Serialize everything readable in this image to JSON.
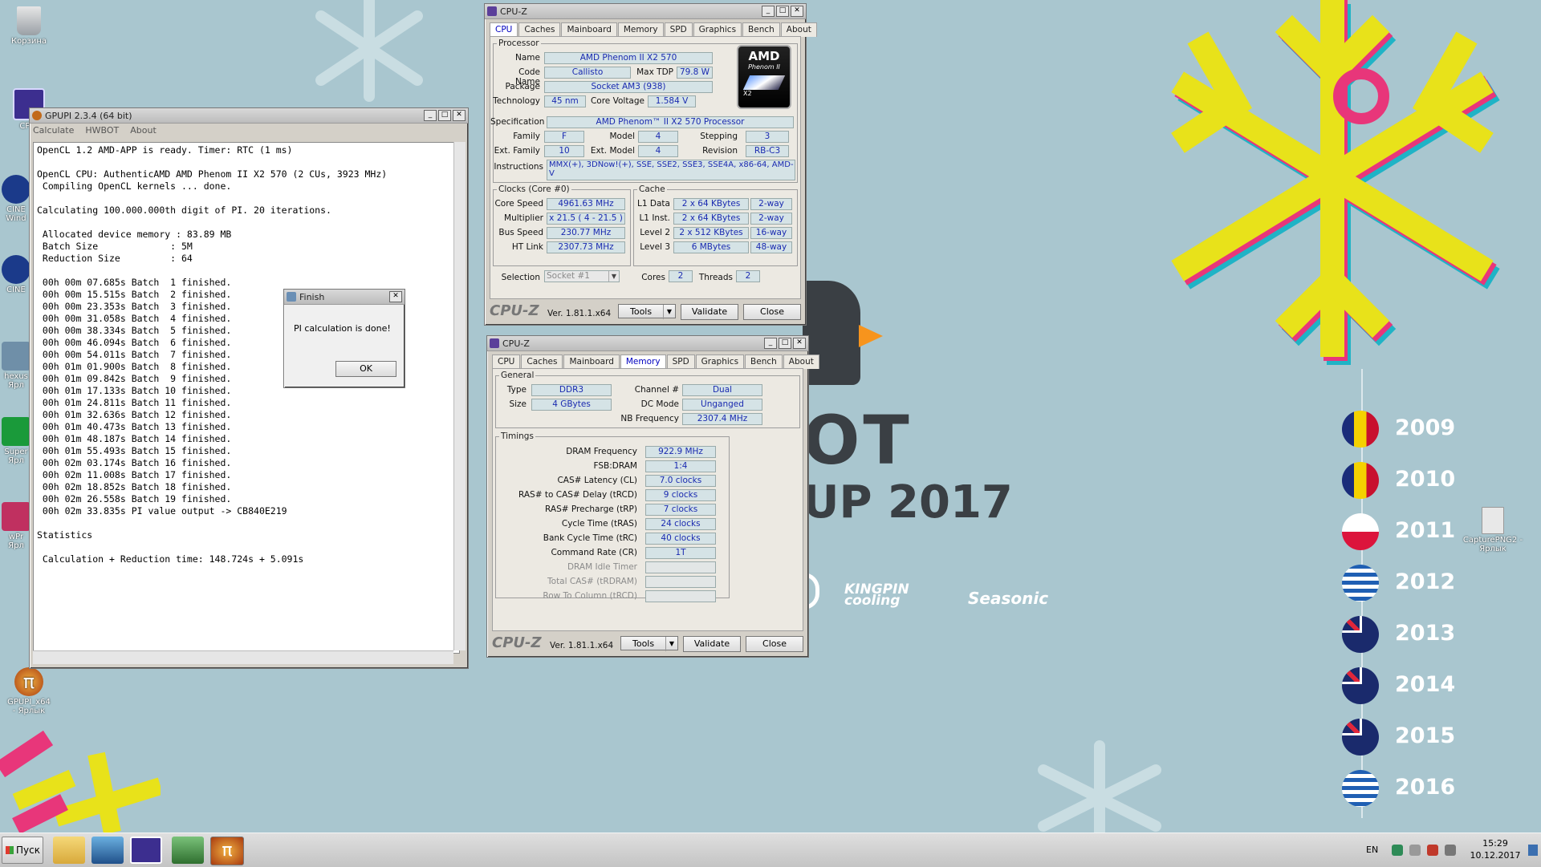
{
  "desktop": {
    "event_text_1": "OT",
    "event_text_2": "UP 2017",
    "sponsor_1": "KINGPIN cooling",
    "sponsor_2": "Seasonic",
    "years": [
      "2009",
      "2010",
      "2011",
      "2012",
      "2013",
      "2014",
      "2015",
      "2016"
    ],
    "icons": [
      {
        "label": "Корзина"
      },
      {
        "label": "CPUI"
      },
      {
        "label": "CINE Wind"
      },
      {
        "label": "CINE"
      },
      {
        "label": "hexus Ярл"
      },
      {
        "label": "Super Ярл"
      },
      {
        "label": "wPr Ярл"
      },
      {
        "label": "GPUPI_x64 - Ярлык"
      },
      {
        "label": "CapturePNG2 - Ярлык"
      }
    ]
  },
  "gpupi": {
    "title": "GPUPI 2.3.4 (64 bit)",
    "menu": [
      "Calculate",
      "HWBOT",
      "About"
    ],
    "lines": [
      "OpenCL 1.2 AMD-APP is ready. Timer: RTC (1 ms)",
      "",
      "OpenCL CPU: AuthenticAMD AMD Phenom II X2 570 (2 CUs, 3923 MHz)",
      " Compiling OpenCL kernels ... done.",
      "",
      "Calculating 100.000.000th digit of PI. 20 iterations.",
      "",
      " Allocated device memory : 83.89 MB",
      " Batch Size             : 5M",
      " Reduction Size         : 64",
      "",
      " 00h 00m 07.685s Batch  1 finished.",
      " 00h 00m 15.515s Batch  2 finished.",
      " 00h 00m 23.353s Batch  3 finished.",
      " 00h 00m 31.058s Batch  4 finished.",
      " 00h 00m 38.334s Batch  5 finished.",
      " 00h 00m 46.094s Batch  6 finished.",
      " 00h 00m 54.011s Batch  7 finished.",
      " 00h 01m 01.900s Batch  8 finished.",
      " 00h 01m 09.842s Batch  9 finished.",
      " 00h 01m 17.133s Batch 10 finished.",
      " 00h 01m 24.811s Batch 11 finished.",
      " 00h 01m 32.636s Batch 12 finished.",
      " 00h 01m 40.473s Batch 13 finished.",
      " 00h 01m 48.187s Batch 14 finished.",
      " 00h 01m 55.493s Batch 15 finished.",
      " 00h 02m 03.174s Batch 16 finished.",
      " 00h 02m 11.008s Batch 17 finished.",
      " 00h 02m 18.852s Batch 18 finished.",
      " 00h 02m 26.558s Batch 19 finished.",
      " 00h 02m 33.835s PI value output -> CB840E219",
      "",
      "Statistics",
      "",
      " Calculation + Reduction time: 148.724s + 5.091s"
    ]
  },
  "finish_dialog": {
    "title": "Finish",
    "message": "PI calculation is done!",
    "ok": "OK"
  },
  "cpuz_cpu": {
    "title": "CPU-Z",
    "tabs": [
      "CPU",
      "Caches",
      "Mainboard",
      "Memory",
      "SPD",
      "Graphics",
      "Bench",
      "About"
    ],
    "active_tab": "CPU",
    "processor_legend": "Processor",
    "name_label": "Name",
    "name": "AMD Phenom II X2 570",
    "codename_label": "Code Name",
    "codename": "Callisto",
    "maxtdp_label": "Max TDP",
    "maxtdp": "79.8 W",
    "package_label": "Package",
    "package": "Socket AM3 (938)",
    "technology_label": "Technology",
    "technology": "45 nm",
    "corevoltage_label": "Core Voltage",
    "corevoltage": "1.584 V",
    "spec_label": "Specification",
    "spec": "AMD Phenom™ II X2 570 Processor",
    "family_label": "Family",
    "family": "F",
    "model_label": "Model",
    "model": "4",
    "stepping_label": "Stepping",
    "stepping": "3",
    "extfamily_label": "Ext. Family",
    "extfamily": "10",
    "extmodel_label": "Ext. Model",
    "extmodel": "4",
    "revision_label": "Revision",
    "revision": "RB-C3",
    "instructions_label": "Instructions",
    "instructions": "MMX(+), 3DNow!(+), SSE, SSE2, SSE3, SSE4A, x86-64, AMD-V",
    "logo_brand": "AMD",
    "logo_sub": "Phenom II",
    "logo_x2": "X2",
    "clocks_legend": "Clocks (Core #0)",
    "corespeed_label": "Core Speed",
    "corespeed": "4961.63 MHz",
    "multiplier_label": "Multiplier",
    "multiplier": "x 21.5 ( 4 - 21.5 )",
    "busspeed_label": "Bus Speed",
    "busspeed": "230.77 MHz",
    "htlink_label": "HT Link",
    "htlink": "2307.73 MHz",
    "cache_legend": "Cache",
    "l1d_label": "L1 Data",
    "l1d": "2 x 64 KBytes",
    "l1d_way": "2-way",
    "l1i_label": "L1 Inst.",
    "l1i": "2 x 64 KBytes",
    "l1i_way": "2-way",
    "l2_label": "Level 2",
    "l2": "2 x 512 KBytes",
    "l2_way": "16-way",
    "l3_label": "Level 3",
    "l3": "6 MBytes",
    "l3_way": "48-way",
    "selection_label": "Selection",
    "selection": "Socket #1",
    "cores_label": "Cores",
    "cores": "2",
    "threads_label": "Threads",
    "threads": "2",
    "footer_logo": "CPU-Z",
    "version": "Ver. 1.81.1.x64",
    "tools": "Tools",
    "validate": "Validate",
    "close": "Close"
  },
  "cpuz_mem": {
    "title": "CPU-Z",
    "tabs": [
      "CPU",
      "Caches",
      "Mainboard",
      "Memory",
      "SPD",
      "Graphics",
      "Bench",
      "About"
    ],
    "active_tab": "Memory",
    "general_legend": "General",
    "type_label": "Type",
    "type": "DDR3",
    "size_label": "Size",
    "size": "4 GBytes",
    "channel_label": "Channel #",
    "channel": "Dual",
    "dcmode_label": "DC Mode",
    "dcmode": "Unganged",
    "nbfreq_label": "NB Frequency",
    "nbfreq": "2307.4 MHz",
    "timings_legend": "Timings",
    "timings": [
      {
        "label": "DRAM Frequency",
        "value": "922.9 MHz"
      },
      {
        "label": "FSB:DRAM",
        "value": "1:4"
      },
      {
        "label": "CAS# Latency (CL)",
        "value": "7.0 clocks"
      },
      {
        "label": "RAS# to CAS# Delay (tRCD)",
        "value": "9 clocks"
      },
      {
        "label": "RAS# Precharge (tRP)",
        "value": "7 clocks"
      },
      {
        "label": "Cycle Time (tRAS)",
        "value": "24 clocks"
      },
      {
        "label": "Bank Cycle Time (tRC)",
        "value": "40 clocks"
      },
      {
        "label": "Command Rate (CR)",
        "value": "1T"
      },
      {
        "label": "DRAM Idle Timer",
        "value": ""
      },
      {
        "label": "Total CAS# (tRDRAM)",
        "value": ""
      },
      {
        "label": "Row To Column (tRCD)",
        "value": ""
      }
    ],
    "footer_logo": "CPU-Z",
    "version": "Ver. 1.81.1.x64",
    "tools": "Tools",
    "validate": "Validate",
    "close": "Close"
  },
  "taskbar": {
    "start": "Пуск",
    "lang": "EN",
    "time": "15:29",
    "date": "10.12.2017"
  }
}
